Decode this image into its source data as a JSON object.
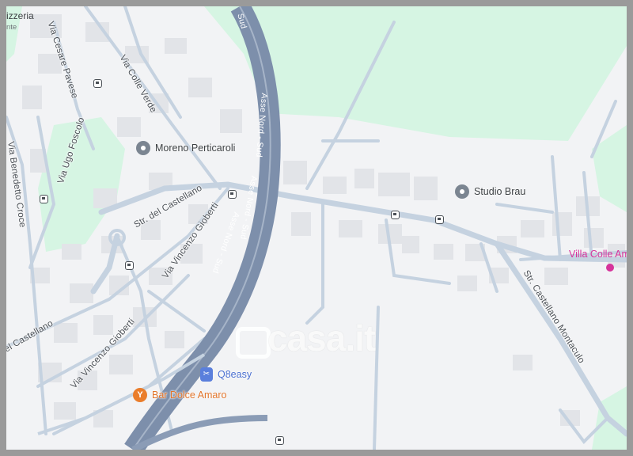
{
  "colors": {
    "background": "#f2f3f5",
    "park": "#d6f5e3",
    "road": "#c5d2e0",
    "highway": "#8b9cb6",
    "building": "#e4e6ea",
    "poi_gray": "#7b8591",
    "poi_orange": "#ea7d2b",
    "poi_blue": "#5a7fdc",
    "place_pink": "#d6339b"
  },
  "streets": {
    "via_cesare_pavese": "Via Cesare Pavese",
    "via_colle_verde": "Via Colle Verde",
    "via_ugo_foscolo": "Via Ugo Foscolo",
    "via_benedetto_croce": "Via Benedetto Croce",
    "str_del_castellano": "Str. del Castellano",
    "via_vincenzo_gioberti_1": "Via Vincenzo Gioberti",
    "via_vincenzo_gioberti_2": "Via Vincenzo Gioberti",
    "del_castellano": "el Castellano",
    "str_castellano_montaculo": "Str. Castellano Montaculo",
    "asse_nord_sud_1": "Sud",
    "asse_nord_sud_2": "Asse Nord - Sud",
    "asse_nord_sud_3": "Asse Nord - Sud",
    "asse_nord_sud_4": "Asse Nord - Sud"
  },
  "pois": {
    "moreno": {
      "name": "Moreno Perticaroli",
      "icon": "place-pin-icon"
    },
    "studio_brau": {
      "name": "Studio Brau",
      "icon": "place-pin-icon"
    },
    "bar": {
      "name": "Bar Dolce Amaro",
      "icon": "cocktail-icon"
    },
    "q8": {
      "name": "Q8easy",
      "icon": "fuel-pump-icon"
    },
    "villa": {
      "name": "Villa Colle Am"
    },
    "pizzeria": {
      "name": "izzeria",
      "sub": "nte"
    }
  },
  "watermark": "casa.it"
}
